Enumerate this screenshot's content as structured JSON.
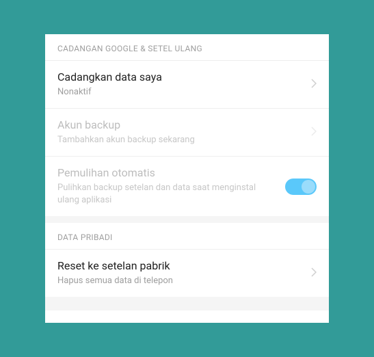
{
  "sections": {
    "google_backup": {
      "header": "CADANGAN GOOGLE & SETEL ULANG",
      "backup_data": {
        "title": "Cadangkan data saya",
        "subtitle": "Nonaktif"
      },
      "backup_account": {
        "title": "Akun backup",
        "subtitle": "Tambahkan akun backup sekarang"
      },
      "auto_restore": {
        "title": "Pemulihan otomatis",
        "subtitle": "Pulihkan backup setelan dan data saat menginstal ulang aplikasi",
        "toggle_on": true
      }
    },
    "personal_data": {
      "header": "DATA PRIBADI",
      "factory_reset": {
        "title": "Reset ke setelan pabrik",
        "subtitle": "Hapus semua data di telepon"
      }
    }
  }
}
